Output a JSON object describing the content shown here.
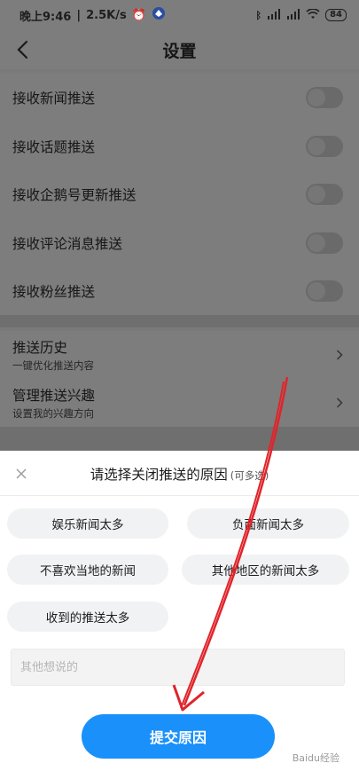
{
  "status_bar": {
    "time": "晚上9:46",
    "speed": "2.5K/s",
    "battery": "84",
    "network": "4G"
  },
  "header": {
    "title": "设置"
  },
  "settings": [
    {
      "label": "接收新闻推送",
      "enabled": false
    },
    {
      "label": "接收话题推送",
      "enabled": false
    },
    {
      "label": "接收企鹅号更新推送",
      "enabled": false
    },
    {
      "label": "接收评论消息推送",
      "enabled": false
    },
    {
      "label": "接收粉丝推送",
      "enabled": false
    }
  ],
  "nav_items": [
    {
      "title": "推送历史",
      "subtitle": "一键优化推送内容"
    },
    {
      "title": "管理推送兴趣",
      "subtitle": "设置我的兴趣方向"
    }
  ],
  "sheet": {
    "title": "请选择关闭推送的原因",
    "hint": "(可多选)",
    "reasons": [
      "娱乐新闻太多",
      "负面新闻太多",
      "不喜欢当地的新闻",
      "其他地区的新闻太多",
      "收到的推送太多"
    ],
    "input_placeholder": "其他想说的",
    "input_value": "",
    "submit_label": "提交原因"
  },
  "watermark": "Baidu经验",
  "colors": {
    "accent": "#1a90fb",
    "overlay": "#7d7d7d",
    "annotation_arrow": "#e0242a"
  }
}
